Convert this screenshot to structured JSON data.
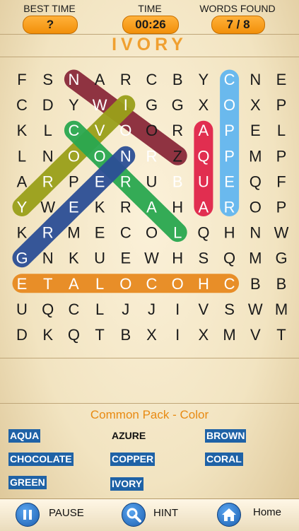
{
  "header": {
    "best_time_label": "BEST TIME",
    "best_time_value": "?",
    "time_label": "TIME",
    "time_value": "00:26",
    "words_found_label": "WORDS FOUND",
    "words_found_value": "7 / 8"
  },
  "current_word": "IVORY",
  "grid": [
    [
      "F",
      "S",
      "N",
      "A",
      "R",
      "C",
      "B",
      "Y",
      "C",
      "N",
      "E"
    ],
    [
      "C",
      "D",
      "Y",
      "W",
      "I",
      "G",
      "G",
      "X",
      "O",
      "X",
      "P"
    ],
    [
      "K",
      "L",
      "C",
      "V",
      "O",
      "O",
      "R",
      "A",
      "P",
      "E",
      "L"
    ],
    [
      "L",
      "N",
      "O",
      "O",
      "N",
      "R",
      "Z",
      "Q",
      "P",
      "M",
      "P"
    ],
    [
      "A",
      "R",
      "P",
      "E",
      "R",
      "U",
      "B",
      "U",
      "E",
      "Q",
      "F"
    ],
    [
      "Y",
      "W",
      "E",
      "K",
      "R",
      "A",
      "H",
      "A",
      "R",
      "O",
      "P"
    ],
    [
      "K",
      "R",
      "M",
      "E",
      "C",
      "O",
      "L",
      "Q",
      "H",
      "N",
      "W"
    ],
    [
      "G",
      "N",
      "K",
      "U",
      "E",
      "W",
      "H",
      "S",
      "Q",
      "M",
      "G"
    ],
    [
      "E",
      "T",
      "A",
      "L",
      "O",
      "C",
      "O",
      "H",
      "C",
      "B",
      "B"
    ],
    [
      "U",
      "Q",
      "C",
      "L",
      "J",
      "J",
      "I",
      "V",
      "S",
      "W",
      "M"
    ],
    [
      "D",
      "K",
      "Q",
      "T",
      "B",
      "X",
      "I",
      "X",
      "M",
      "V",
      "T"
    ]
  ],
  "highlights": [
    {
      "word": "BROWN",
      "color": "#8a2a3a",
      "from": [
        0,
        2
      ],
      "to": [
        3,
        6
      ]
    },
    {
      "word": "IVORY",
      "color": "#9aa01a",
      "from": [
        1,
        4
      ],
      "to": [
        5,
        0
      ]
    },
    {
      "word": "CORAL",
      "color": "#2aa850",
      "from": [
        2,
        2
      ],
      "to": [
        6,
        6
      ]
    },
    {
      "word": "GREEN",
      "color": "#2c4f96",
      "from": [
        3,
        4
      ],
      "to": [
        7,
        0
      ]
    },
    {
      "word": "AQUA",
      "color": "#e0244a",
      "from": [
        2,
        7
      ],
      "to": [
        5,
        7
      ]
    },
    {
      "word": "COPPER",
      "color": "#63b7f0",
      "from": [
        0,
        8
      ],
      "to": [
        5,
        8
      ]
    },
    {
      "word": "CHOCOLATE",
      "color": "#e88a20",
      "from": [
        8,
        8
      ],
      "to": [
        8,
        0
      ]
    }
  ],
  "pack_title": "Common Pack - Color",
  "words": [
    {
      "label": "AQUA",
      "found": true
    },
    {
      "label": "AZURE",
      "found": false
    },
    {
      "label": "BROWN",
      "found": true
    },
    {
      "label": "CHOCOLATE",
      "found": true
    },
    {
      "label": "COPPER",
      "found": true
    },
    {
      "label": "CORAL",
      "found": true
    },
    {
      "label": "GREEN",
      "found": true
    },
    {
      "label": "IVORY",
      "found": true
    }
  ],
  "footer": {
    "pause_label": "PAUSE",
    "hint_label": "HINT",
    "home_label": "Home",
    "pause_icon": "pause-icon",
    "hint_icon": "magnifier-icon",
    "home_icon": "home-icon"
  }
}
